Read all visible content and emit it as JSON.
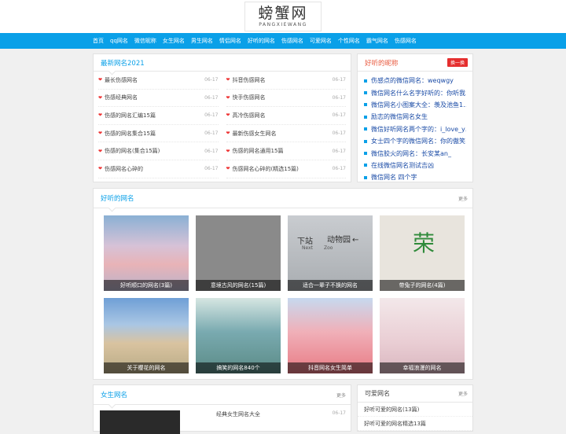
{
  "site": {
    "logo_cn": "螃蟹网",
    "logo_en": "PANGXIEWANG"
  },
  "nav": [
    "首页",
    "qq网名",
    "微信昵称",
    "女生网名",
    "男生网名",
    "情侣网名",
    "好听的网名",
    "伤感网名",
    "可爱网名",
    "个性网名",
    "霸气网名",
    "伤感网名"
  ],
  "latest": {
    "title": "最新网名2021",
    "left": [
      {
        "text": "最长伤感网名",
        "date": "06-17"
      },
      {
        "text": "伤感经典网名",
        "date": "06-17"
      },
      {
        "text": "伤感的网名汇编15篇",
        "date": "06-17"
      },
      {
        "text": "伤感的网名集合15篇",
        "date": "06-17"
      },
      {
        "text": "伤感的网名(集合15篇)",
        "date": "06-17"
      },
      {
        "text": "伤感网名心碎的",
        "date": "06-17"
      }
    ],
    "right": [
      {
        "text": "抖音伤感网名",
        "date": "06-17"
      },
      {
        "text": "快手伤感网名",
        "date": "06-17"
      },
      {
        "text": "高冷伤感网名",
        "date": "06-17"
      },
      {
        "text": "最新伤感女生网名",
        "date": "06-17"
      },
      {
        "text": "伤感的网名通用15篇",
        "date": "06-17"
      },
      {
        "text": "伤感网名心碎的(精选15篇)",
        "date": "06-17"
      }
    ]
  },
  "nicknames": {
    "title": "好听的昵称",
    "refresh": "换一换",
    "items": [
      "伤感点的微信网名：weqwgy",
      "微信网名什么名字好听的：你听我…",
      "微信网名小图案大全：羡及池鱼1…",
      "励志的微信网名女生",
      "微信好听网名两个字的：i_love_y…",
      "女士四个字的微信网名：你的傲笑…",
      "微信胶火的网名：长安某an_",
      "在线微信网名测试吉凶",
      "微信网名 四个字"
    ]
  },
  "gallery": {
    "title": "好听的网名",
    "more": "更多",
    "items": [
      {
        "caption": "好听顺口的网名(3篇)",
        "icon": "pink-sunset-sky-photo"
      },
      {
        "caption": "意境古风的网名(15篇)",
        "icon": "gray-photo"
      },
      {
        "caption": "适合一辈子不换的网名",
        "icon": "subway-sign-photo"
      },
      {
        "caption": "带兔子的网名(4篇)",
        "icon": "doodle-character-photo"
      },
      {
        "caption": "关于樱花的网名",
        "icon": "girl-in-field-photo"
      },
      {
        "caption": "搞笑的网名840个",
        "icon": "city-river-photo"
      },
      {
        "caption": "抖音网名女生简单",
        "icon": "pink-ribbon-photo"
      },
      {
        "caption": "幸福浪漫的网名",
        "icon": "little-girl-photo"
      }
    ],
    "sign": {
      "a": "下站",
      "b": "动物园",
      "c": "Next",
      "d": "Zoo",
      "e": "荣"
    }
  },
  "girls": {
    "title": "女生网名",
    "more": "更多",
    "first": {
      "text": "经典女生网名大全",
      "date": "06-17"
    }
  },
  "cute": {
    "title": "可爱网名",
    "more": "更多",
    "items": [
      "好听可爱的网名(13篇)",
      "好听可爱的网名精选13篇"
    ]
  }
}
